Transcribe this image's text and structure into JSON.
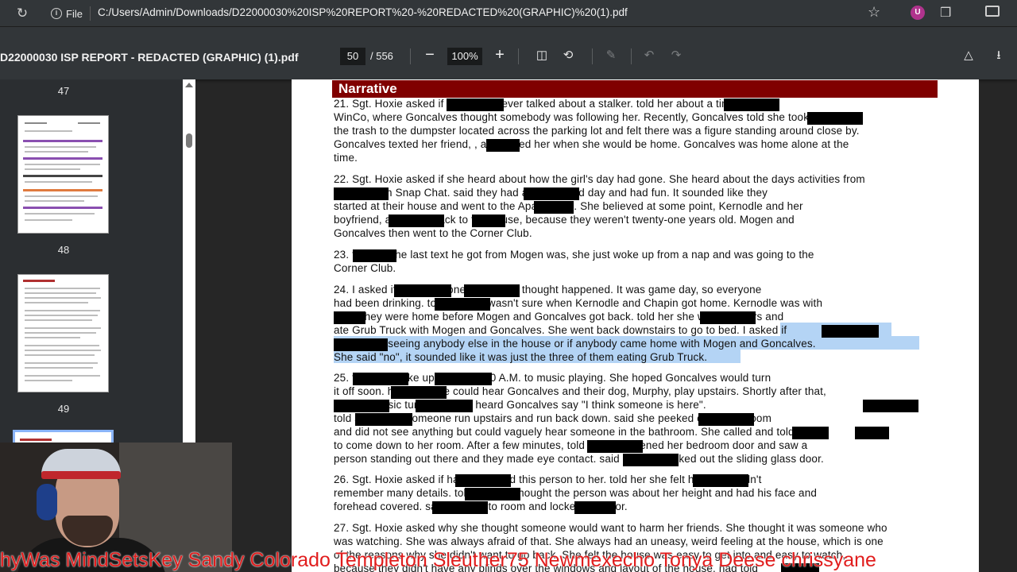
{
  "browser": {
    "scheme_label": "File",
    "url": "C:/Users/Admin/Downloads/D22000030%20ISP%20REPORT%20-%20REDACTED%20(GRAPHIC)%20(1).pdf",
    "extension_badge": "U"
  },
  "pdf_toolbar": {
    "title": "D22000030 ISP REPORT - REDACTED (GRAPHIC) (1).pdf",
    "current_page": "50",
    "total_pages": "/ 556",
    "zoom": "100%"
  },
  "sidebar": {
    "page_labels": [
      "47",
      "48",
      "49"
    ]
  },
  "document": {
    "heading": "Narrative",
    "lines": [
      "21. Sgt. Hoxie asked                  if Goncalves ever talked about a stalker.                    told her about a time at",
      "WinCo, where Goncalves thought somebody was following her. Recently, Goncalves told                    she took out",
      "the trash to the dumpster located across the parking lot and felt there was a figure standing around close by.",
      "Goncalves texted her friend,            , and asked her when she would be home.  Goncalves was home alone at the",
      "time.",
      "22. Sgt. Hoxie asked if she heard about how the girl's day had gone. She heard about the days activities from",
      "                    and through Snap Chat.                    said they had a really good day and had fun. It sounded like they",
      "started at their house and went to the              Apartments. She believed at some point, Kernodle and her",
      "boyfriend,                    and             went back to the house, because they weren't twenty-one years old. Mogen and",
      "Goncalves then went to the Corner Club.",
      "23.                 told her the last text he got from Mogen was, she just woke up from a nap and was going to the",
      "Corner Club.",
      "24. I asked                     if                       had mentioned what she thought happened. It was game day, so everyone",
      "had been drinking.                    told her she wasn't sure when Kernodle and Chapin got home. Kernodle was with",
      "            , and they were home before Mogen and Goncalves got back.                    told her she went upstairs and",
      "ate Grub Truck with Mogen and Goncalves. She went back downstairs to go to bed. I asked                     if",
      "                    mentioned seeing anybody else in the house or if anybody came home with Mogen and Goncalves.",
      "She said \"no\", it sounded like it was just the three of them eating Grub Truck.",
      "25.                     told                       she woke up around 4:00 A.M. to music playing. She hoped Goncalves would turn",
      "it off soon.                    had said she could hear Goncalves and their dog, Murphy, play upstairs. Shortly after that,",
      "                    told                       the music turned off and heard Goncalves say \"I think someone is here\".",
      "told                     she heard someone run upstairs and run back down.                    said she peeked out of her room",
      "and did not see anything but could vaguely hear someone in the bathroom. She called              and              told her",
      "to come down to her room. After a few minutes,                    told her she opened her bedroom door and saw a",
      "person standing out there and they made eye contact.                    said he then walked out the sliding glass door.",
      "26. Sgt. Hoxie asked if                     had described this person to her.                    told her she felt hazy and didn't",
      "remember many details.                    told her she thought the person was about her height and had his face and",
      "forehead covered.                    said she ran to                room and locked the door.",
      "27. Sgt. Hoxie asked why she thought someone would want to harm her friends. She thought it was someone who",
      "was watching. She was always afraid of that. She always had an uneasy, weird feeling at the house, which is one",
      "of the reasons why she didn't want to go back. She felt the house was easy to get into and easy to watch,",
      "because they didn't have any blinds over the windows and layout of the house.              had told"
    ]
  },
  "overlay": {
    "ticker": "hyWas MindSetsKey   Sandy Colorado   Templeton Sleuther75   Newmexecho Tonya Deese chrissyane"
  },
  "colors": {
    "narrative_header": "#800000",
    "selection_highlight": "#b4d4f5",
    "ticker_text": "#e11d1d"
  }
}
